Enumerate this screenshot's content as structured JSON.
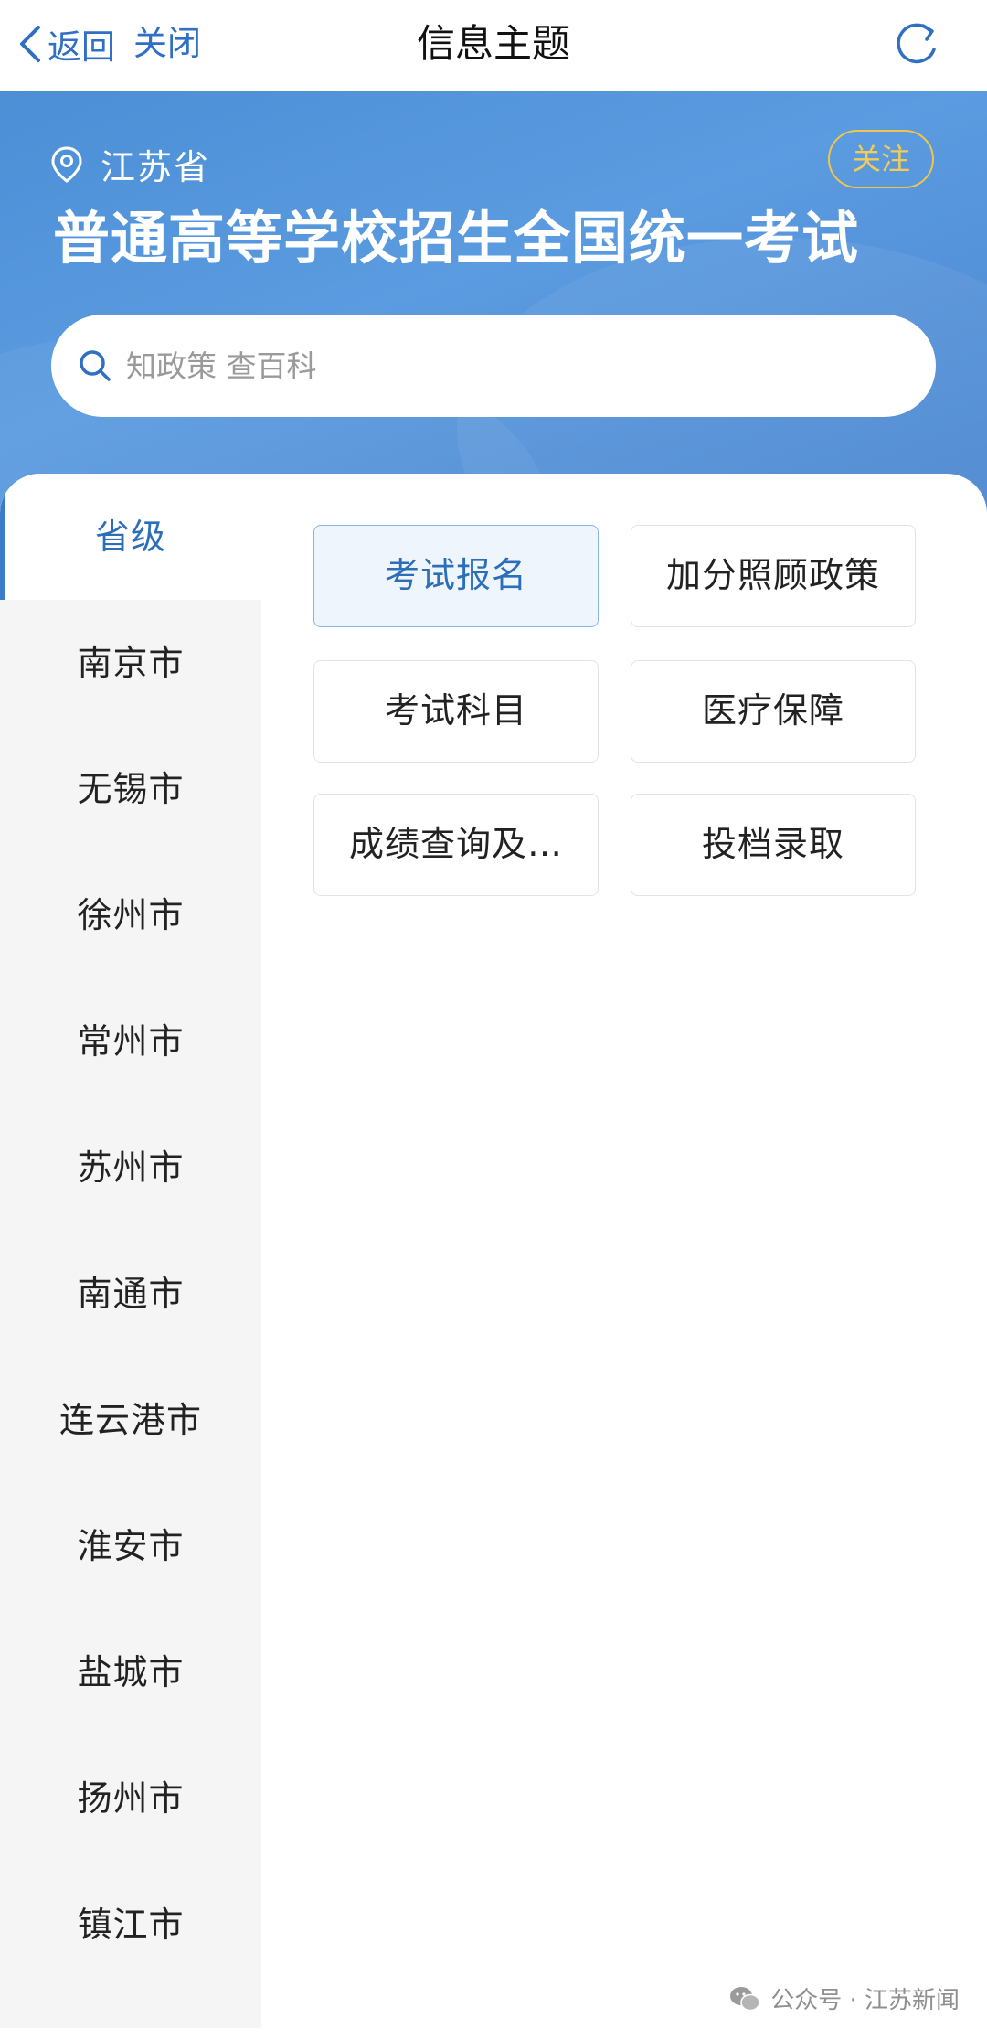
{
  "nav": {
    "back_label": "返回",
    "close_label": "关闭",
    "title": "信息主题"
  },
  "header": {
    "location": "江苏省",
    "follow_label": "关注",
    "title": "普通高等学校招生全国统一考试",
    "search_placeholder": "知政策 查百科"
  },
  "sidebar": {
    "items": [
      {
        "label": "省级",
        "active": true
      },
      {
        "label": "南京市"
      },
      {
        "label": "无锡市"
      },
      {
        "label": "徐州市"
      },
      {
        "label": "常州市"
      },
      {
        "label": "苏州市"
      },
      {
        "label": "南通市"
      },
      {
        "label": "连云港市"
      },
      {
        "label": "淮安市"
      },
      {
        "label": "盐城市"
      },
      {
        "label": "扬州市"
      },
      {
        "label": "镇江市"
      }
    ]
  },
  "topics": [
    {
      "label": "考试报名",
      "active": true
    },
    {
      "label": "加分照顾政策"
    },
    {
      "label": "考试科目"
    },
    {
      "label": "医疗保障"
    },
    {
      "label": "成绩查询及…"
    },
    {
      "label": "投档录取"
    }
  ],
  "watermark": {
    "text": "公众号 · 江苏新闻"
  },
  "colors": {
    "accent": "#2f6fc4",
    "header_bg": "#4c8fd6",
    "follow": "#f0c64a"
  }
}
